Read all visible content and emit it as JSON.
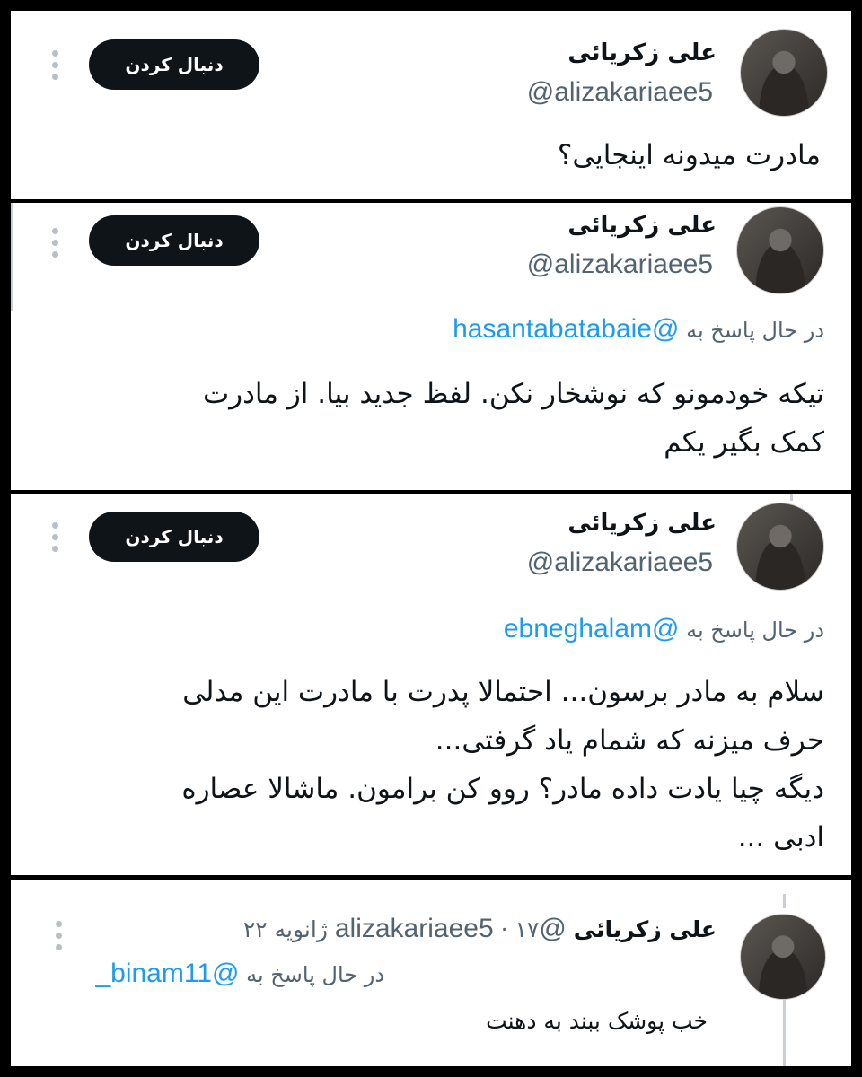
{
  "tweets": [
    {
      "name": "علی زکریائی",
      "handle": "@alizakariaee5",
      "follow_label": "دنبال کردن",
      "text": "مادرت میدونه اینجایی؟"
    },
    {
      "name": "علی زکریائی",
      "handle": "@alizakariaee5",
      "follow_label": "دنبال کردن",
      "replying_prefix": "در حال پاسخ به",
      "replying_to": "@hasantabatabaie",
      "text": "تیکه خودمونو که نوشخار نکن. لفظ جدید بیا. از مادرت\nکمک بگیر یکم"
    },
    {
      "name": "علی زکریائی",
      "handle": "@alizakariaee5",
      "follow_label": "دنبال کردن",
      "replying_prefix": "در حال پاسخ به",
      "replying_to": "@ebneghalam",
      "text": "سلام به مادر برسون... احتمالا پدرت با مادرت این مدلی\nحرف میزنه که شمام یاد گرفتی...\nدیگه چیا یادت داده مادر؟ روو کن برامون. ماشالا عصاره\nادبی ..."
    },
    {
      "name": "علی زکریائی",
      "handle": "@alizakariaee5",
      "separator": "·",
      "date": "۱۷ ژانویه ۲۲",
      "replying_prefix": "در حال پاسخ به",
      "replying_to": "@binam11_",
      "text": "خب پوشک ببند به دهنت"
    }
  ],
  "icons": {
    "more": "more-vertical-icon",
    "avatar": "avatar"
  }
}
